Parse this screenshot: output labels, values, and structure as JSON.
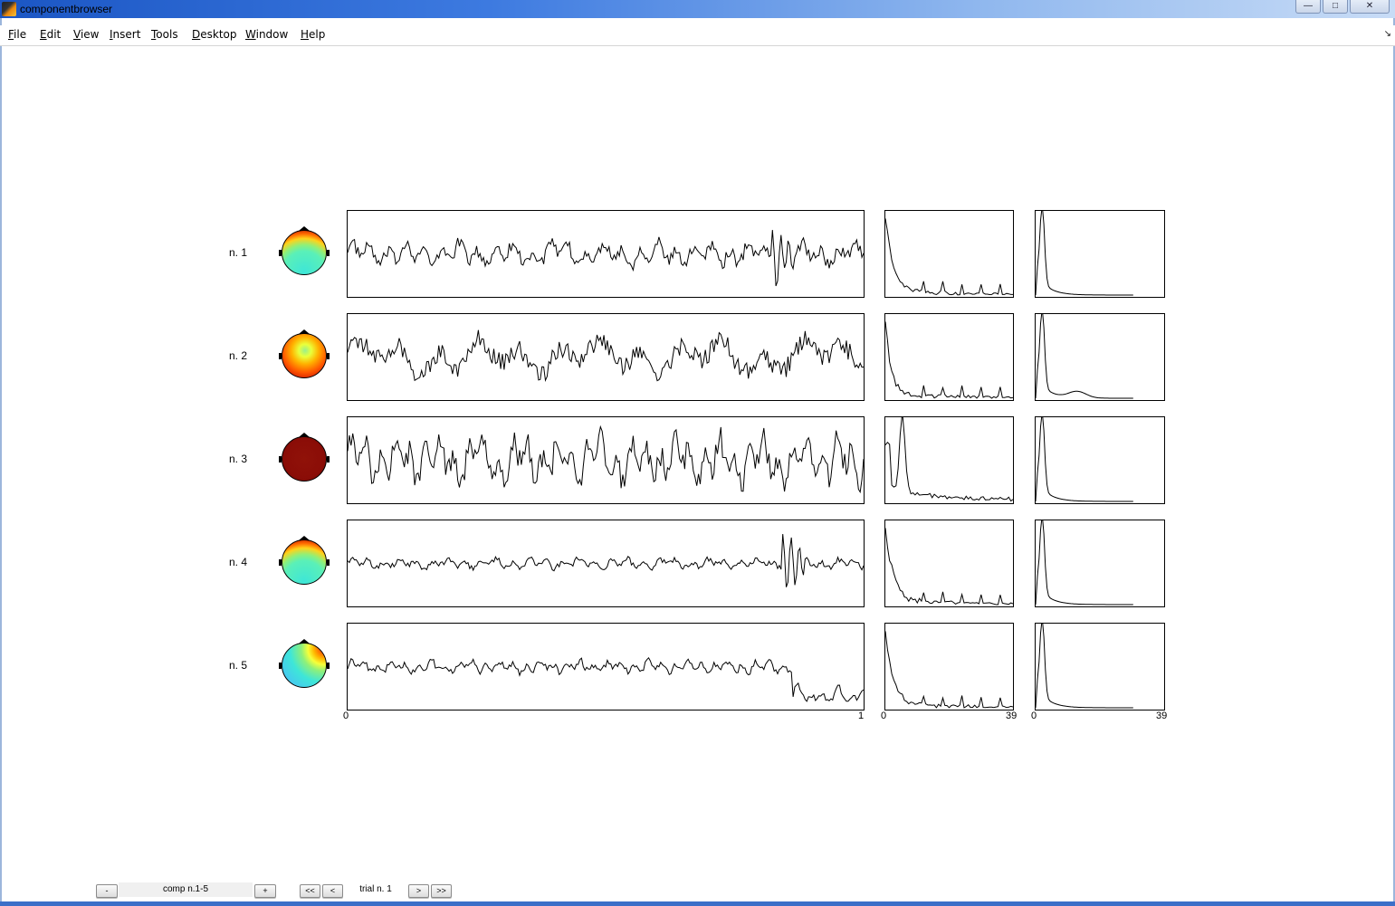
{
  "window": {
    "title": "componentbrowser",
    "buttons": {
      "minimize": "—",
      "maximize": "□",
      "close": "✕"
    }
  },
  "menu": {
    "items": [
      "File",
      "Edit",
      "View",
      "Insert",
      "Tools",
      "Desktop",
      "Window",
      "Help"
    ]
  },
  "components": [
    {
      "label": "n. 1",
      "topo": "frontal",
      "signal_amp": 0.35,
      "signal_freq": 9,
      "artifact": 0.82
    },
    {
      "label": "n. 2",
      "topo": "central",
      "signal_amp": 0.55,
      "signal_freq": 4,
      "artifact": -1
    },
    {
      "label": "n. 3",
      "topo": "uniform",
      "signal_amp": 0.7,
      "signal_freq": 11,
      "artifact": -1
    },
    {
      "label": "n. 4",
      "topo": "frontal",
      "signal_amp": 0.15,
      "signal_freq": 10,
      "artifact": 0.84
    },
    {
      "label": "n. 5",
      "topo": "lateral",
      "signal_amp": 0.18,
      "signal_freq": 12,
      "artifact": 0.86
    }
  ],
  "axes_ticks": {
    "time": {
      "min": "0",
      "max": "1"
    },
    "freq1": {
      "min": "0",
      "max": "39"
    },
    "freq2": {
      "min": "0",
      "max": "39"
    }
  },
  "controls": {
    "comp_minus": "-",
    "comp_label": "comp n.1-5",
    "comp_plus": "+",
    "trial_first": "<<",
    "trial_prev": "<",
    "trial_label": "trial n. 1",
    "trial_next": ">",
    "trial_last": ">>"
  },
  "colors": {
    "title_gradient_start": "#1b56c4",
    "topo_dark_red": "#8b0d07",
    "topo_cyan": "#3ee6d8",
    "topo_green": "#8ef07a"
  }
}
